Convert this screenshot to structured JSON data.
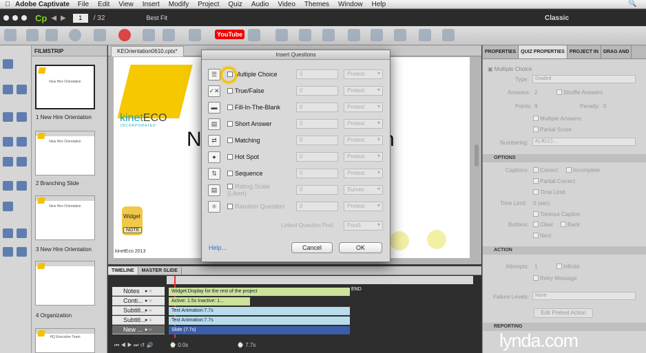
{
  "menubar": {
    "apple": "",
    "app_name": "Adobe Captivate",
    "items": [
      "File",
      "Edit",
      "View",
      "Insert",
      "Modify",
      "Project",
      "Quiz",
      "Audio",
      "Video",
      "Themes",
      "Window",
      "Help"
    ]
  },
  "appbar": {
    "logo": "Cp",
    "slide_current": "1",
    "slide_total": "/ 32",
    "zoom": "Best Fit",
    "workspace": "Classic",
    "youtube": "YouTube"
  },
  "filmstrip": {
    "header": "FILMSTRIP",
    "slides": [
      {
        "label": "1 New Hire Orientation",
        "thumb_title": "New Hire Orientation"
      },
      {
        "label": "2 Branching Slide",
        "thumb_title": "New Hire Orientation"
      },
      {
        "label": "3 New Hire Orientation",
        "thumb_title": "New Hire Orientation"
      },
      {
        "label": "4 Organization",
        "thumb_title": ""
      },
      {
        "label": "",
        "thumb_title": "HQ Executive Team"
      }
    ]
  },
  "document": {
    "tab": "KEOrientation0610.cptx*",
    "logo_text": "kinet",
    "logo_eco": "ECO",
    "logo_sub": "INCORPORATED",
    "title_left": "N",
    "title_right": "n",
    "widget": "Widget",
    "widget_note": "NOTE",
    "footer": "kinetEco 2013"
  },
  "props": {
    "tabs": [
      "PROPERTIES",
      "QUIZ PROPERTIES",
      "PROJECT IN",
      "DRAG AND"
    ],
    "quiz_type": "Multiple Choice",
    "type_label": "Type:",
    "type_value": "Graded",
    "answers_label": "Answers:",
    "answers_value": "2",
    "shuffle": "Shuffle Answers",
    "points_label": "Points:",
    "points_value": "9",
    "penalty_label": "Penalty:",
    "penalty_value": "0",
    "multiple_answers": "Multiple Answers",
    "partial_score": "Partial Score",
    "numbering_label": "Numbering:",
    "numbering_value": "A),B),C),...",
    "options_header": "OPTIONS",
    "captions_label": "Captions:",
    "correct": "Correct",
    "incomplete": "Incomplete",
    "partial_correct": "Partial Correct",
    "time_limit": "Time Limit",
    "time_limit_label": "Time Limit:",
    "time_limit_value": "0 (sec)",
    "timeout_caption": "Timeout Caption",
    "buttons_label": "Buttons:",
    "clear": "Clear",
    "back": "Back",
    "next": "Next",
    "action_header": "ACTION",
    "attempts_label": "Attempts:",
    "attempts_value": "1",
    "infinite": "Infinite",
    "retry": "Retry Message",
    "failure_label": "Failure Levels:",
    "failure_value": "None",
    "edit_btn": "Edit Pretest Action",
    "reporting_header": "REPORTING"
  },
  "timeline": {
    "tabs": [
      "TIMELINE",
      "MASTER SLIDE"
    ],
    "rows": [
      {
        "name": "Notes",
        "track": "Widget:Display for the rest of the project"
      },
      {
        "name": "Conti...",
        "track": "Active: 1.5s   Inactive: 1..."
      },
      {
        "name": "Subtitl...",
        "track": "Text Animation:7.7s"
      },
      {
        "name": "Subtitl...",
        "track": "Text Animation:7.7s"
      },
      {
        "name": "New ...",
        "track": "Slide (7.7s)"
      }
    ],
    "end": "END",
    "time_start": "0.0s",
    "time_dur": "7.7s"
  },
  "dialog": {
    "title": "Insert Questions",
    "questions": [
      {
        "label": "Multiple Choice",
        "count": "0",
        "type": "Pretest",
        "enabled": true
      },
      {
        "label": "True/False",
        "count": "0",
        "type": "Pretest",
        "enabled": true
      },
      {
        "label": "Fill-In-The-Blank",
        "count": "0",
        "type": "Pretest",
        "enabled": true
      },
      {
        "label": "Short Answer",
        "count": "0",
        "type": "Pretest",
        "enabled": true
      },
      {
        "label": "Matching",
        "count": "0",
        "type": "Pretest",
        "enabled": true
      },
      {
        "label": "Hot Spot",
        "count": "0",
        "type": "Pretest",
        "enabled": true
      },
      {
        "label": "Sequence",
        "count": "0",
        "type": "Pretest",
        "enabled": true
      },
      {
        "label": "Rating Scale (Likert)",
        "count": "0",
        "type": "Survey",
        "enabled": false
      },
      {
        "label": "Random Question",
        "count": "0",
        "type": "Pretest",
        "enabled": false
      }
    ],
    "pool_label": "Linked Question Pool",
    "pool_value": "Pool1",
    "help": "Help...",
    "cancel": "Cancel",
    "ok": "OK"
  },
  "watermark": "lynda.com"
}
